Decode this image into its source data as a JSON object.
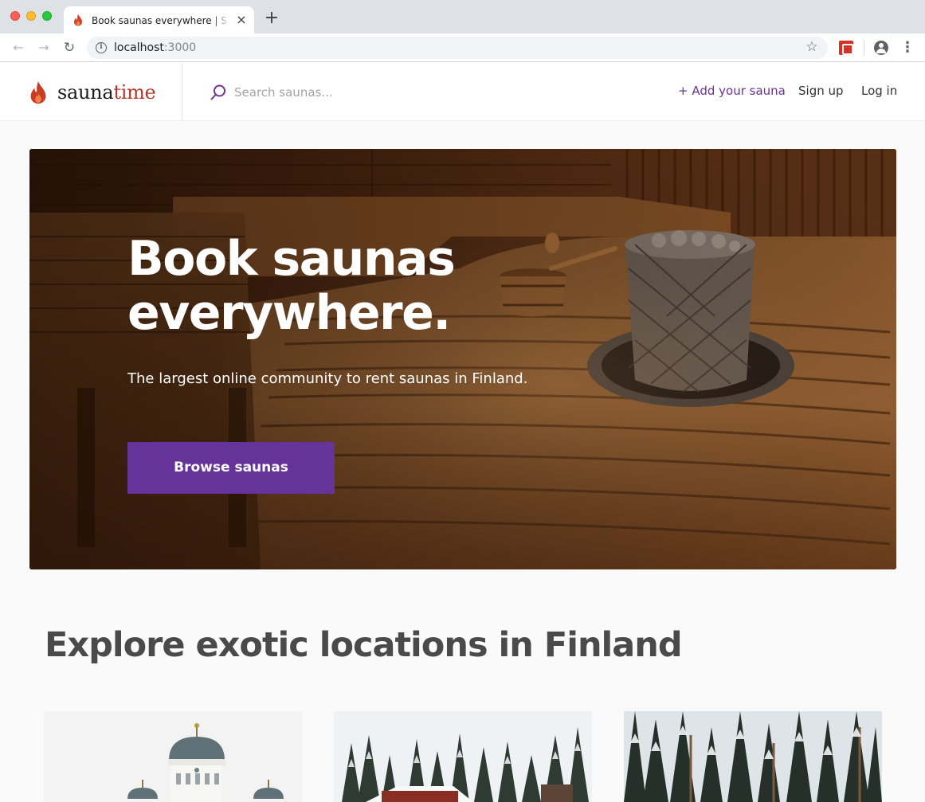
{
  "browser": {
    "tab_title": "Book saunas everywhere | Saunatime",
    "url_host": "localhost",
    "url_port": ":3000",
    "tab_close_glyph": "×",
    "new_tab_glyph": "+",
    "icons": [
      "flame-favicon-icon",
      "close-icon",
      "plus-icon",
      "back-icon",
      "forward-icon",
      "reload-icon",
      "info-icon",
      "star-icon",
      "extension-icon",
      "profile-icon",
      "more-menu-icon"
    ]
  },
  "header": {
    "logo_part1": "sauna",
    "logo_part2": "time",
    "search_placeholder": "Search saunas...",
    "add_link": "+ Add your sauna",
    "signup_link": "Sign up",
    "login_link": "Log in",
    "brand_color": "#b5362a",
    "accent_color": "#66339b"
  },
  "hero": {
    "title_line1": "Book saunas",
    "title_line2": "everywhere.",
    "subtitle": "The largest online community to rent saunas in Finland.",
    "cta_label": "Browse saunas"
  },
  "locations": {
    "title": "Explore exotic locations in Finland",
    "cards": [
      {
        "image": "helsinki-cathedral-photo"
      },
      {
        "image": "snowy-cabin-forest-photo"
      },
      {
        "image": "snowy-pine-forest-photo"
      }
    ]
  }
}
